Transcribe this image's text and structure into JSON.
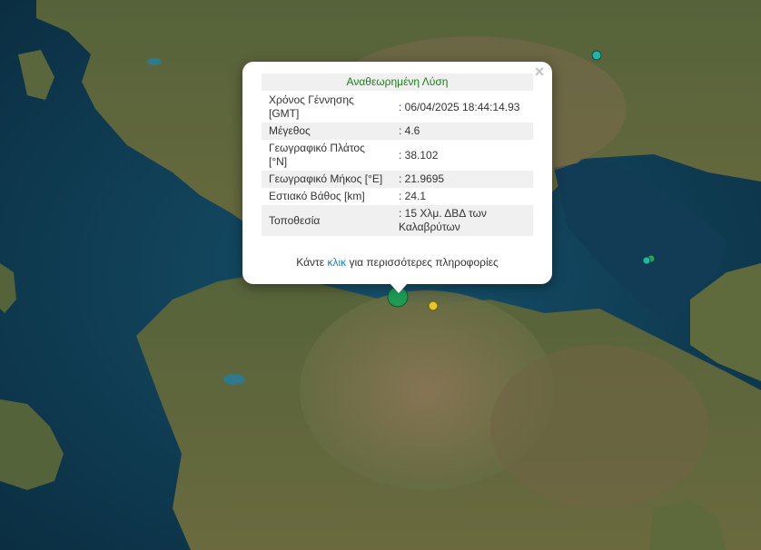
{
  "popup": {
    "close_icon": "×",
    "title": "Αναθεωρημένη Λύση",
    "rows": [
      {
        "key": "Χρόνος Γέννησης [GMT]",
        "value": ": 06/04/2025 18:44:14.93"
      },
      {
        "key": "Μέγεθος",
        "value": ": 4.6"
      },
      {
        "key": "Γεωγραφικό Πλάτος [°N]",
        "value": ": 38.102"
      },
      {
        "key": "Γεωγραφικό Μήκος [°E]",
        "value": ": 21.9695"
      },
      {
        "key": "Εστιακό Βάθος [km]",
        "value": ": 24.1"
      },
      {
        "key": "Τοποθεσία",
        "value": ": 15 Χλμ. ΔΒΔ των Καλαβρύτων"
      }
    ],
    "more_prefix": "Κάντε",
    "more_link": "κλικ",
    "more_suffix": "για περισσότερες πληροφορίες"
  },
  "markers": [
    {
      "name": "quake-marker-selected",
      "color": "#1f9a55"
    },
    {
      "name": "quake-marker-yellow",
      "color": "#e6c42a"
    },
    {
      "name": "quake-marker-cyan-north",
      "color": "#22b6a8"
    },
    {
      "name": "quake-marker-cyan-east",
      "color": "#22b6a8"
    },
    {
      "name": "quake-marker-green-east",
      "color": "#2e9e5e"
    }
  ],
  "colors": {
    "sea": "#0f3a52",
    "land": "#5e6a3a",
    "mountain": "#7d6a4c",
    "title_green": "#1a7f1a",
    "link_blue": "#1a7fbf"
  }
}
